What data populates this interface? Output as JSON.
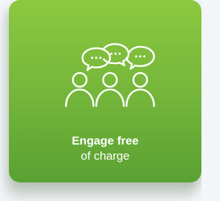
{
  "card": {
    "title": "Engage free",
    "subtitle": "of charge",
    "icon": "people-chat-icon",
    "colors": {
      "gradient_top": "#8cc83f",
      "gradient_bottom": "#5aa133",
      "text": "#ffffff",
      "icon_stroke": "#ffffff"
    }
  }
}
